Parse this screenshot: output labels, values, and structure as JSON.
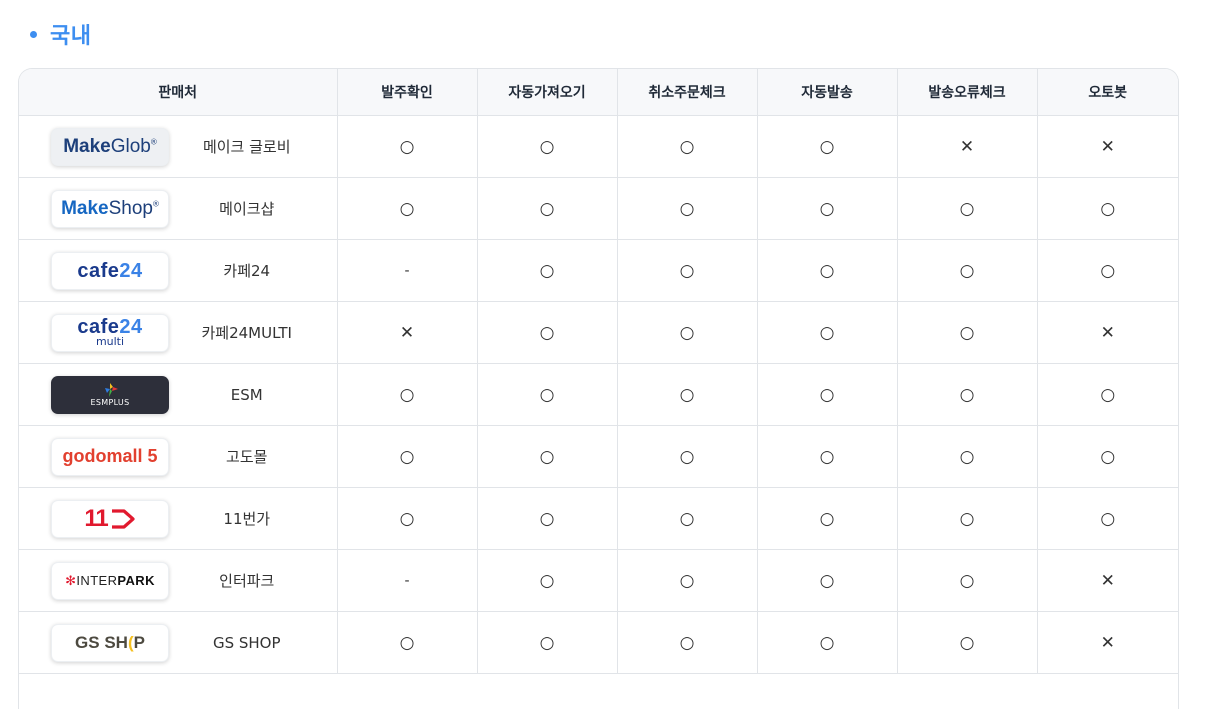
{
  "section": {
    "title": "국내"
  },
  "columns": [
    "판매처",
    "발주확인",
    "자동가져오기",
    "취소주문체크",
    "자동발송",
    "발송오류체크",
    "오토봇"
  ],
  "rows": [
    {
      "name": "메이크 글로비",
      "logo_icon": "makeglob-logo",
      "logo_text": "MakeGlob",
      "marks": [
        "O",
        "O",
        "O",
        "O",
        "X",
        "X"
      ]
    },
    {
      "name": "메이크샵",
      "logo_icon": "makeshop-logo",
      "logo_text": "MakeShop",
      "marks": [
        "O",
        "O",
        "O",
        "O",
        "O",
        "O"
      ]
    },
    {
      "name": "카페24",
      "logo_icon": "cafe24-logo",
      "logo_text": "cafe24",
      "marks": [
        "-",
        "O",
        "O",
        "O",
        "O",
        "O"
      ]
    },
    {
      "name": "카페24MULTI",
      "logo_icon": "cafe24-multi-logo",
      "logo_text": "cafe24",
      "logo_sub": "multi",
      "marks": [
        "X",
        "O",
        "O",
        "O",
        "O",
        "X"
      ]
    },
    {
      "name": "ESM",
      "logo_icon": "esmplus-logo",
      "logo_sub": "ESMPLUS",
      "marks": [
        "O",
        "O",
        "O",
        "O",
        "O",
        "O"
      ]
    },
    {
      "name": "고도몰",
      "logo_icon": "godomall-logo",
      "logo_text": "godomall 5",
      "marks": [
        "O",
        "O",
        "O",
        "O",
        "O",
        "O"
      ]
    },
    {
      "name": "11번가",
      "logo_icon": "11st-logo",
      "logo_text": "11",
      "marks": [
        "O",
        "O",
        "O",
        "O",
        "O",
        "O"
      ]
    },
    {
      "name": "인터파크",
      "logo_icon": "interpark-logo",
      "logo_text": "INTERPARK",
      "marks": [
        "-",
        "O",
        "O",
        "O",
        "O",
        "X"
      ]
    },
    {
      "name": "GS SHOP",
      "logo_icon": "gsshop-logo",
      "logo_text": "GS SHOP",
      "marks": [
        "O",
        "O",
        "O",
        "O",
        "O",
        "X"
      ]
    }
  ],
  "colors": {
    "accent": "#3d8ef0",
    "border": "#e1e4e8",
    "header_bg": "#f7f8fa"
  }
}
